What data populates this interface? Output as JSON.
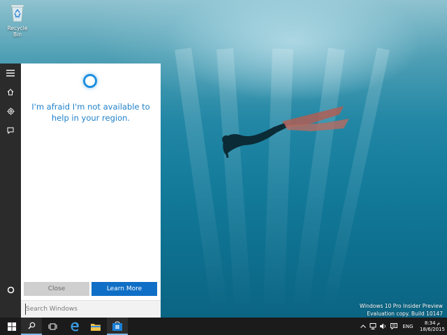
{
  "desktop": {
    "recycle_bin_label": "Recycle Bin",
    "watermark_line1": "Windows 10 Pro Insider Preview",
    "watermark_line2": "Evaluation copy. Build 10147"
  },
  "rail": {
    "items": [
      {
        "icon": "hamburger-menu-icon"
      },
      {
        "icon": "home-icon"
      },
      {
        "icon": "notebook-gear-icon"
      },
      {
        "icon": "feedback-icon"
      },
      {
        "icon": "cortana-circle-icon"
      }
    ]
  },
  "cortana": {
    "message": "I'm afraid I'm not available to help in your region.",
    "close_label": "Close",
    "learn_more_label": "Learn More",
    "search_placeholder": "Search Windows",
    "accent": "#1e8fe0"
  },
  "taskbar": {
    "buttons": [
      {
        "icon": "windows-start-icon"
      },
      {
        "icon": "search-icon"
      },
      {
        "icon": "task-view-icon"
      },
      {
        "icon": "edge-icon"
      },
      {
        "icon": "file-explorer-icon"
      },
      {
        "icon": "store-icon"
      }
    ],
    "tray": {
      "language": "ENG",
      "time": "8:34 م",
      "date": "18/6/2015"
    }
  }
}
